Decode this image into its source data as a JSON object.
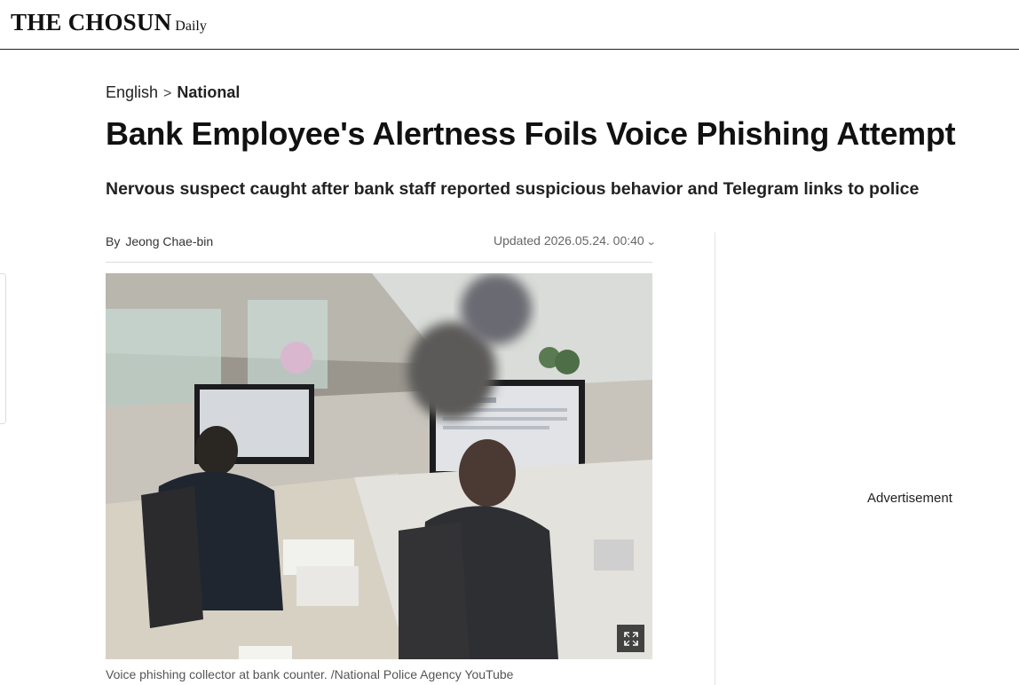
{
  "header": {
    "logo_main": "THE CHOSUN",
    "logo_sub": "Daily"
  },
  "breadcrumb": {
    "section": "English",
    "separator": ">",
    "current": "National"
  },
  "article": {
    "headline": "Bank Employee's Alertness Foils Voice Phishing Attempt",
    "subheadline": "Nervous suspect caught after bank staff reported suspicious behavior and Telegram links to police",
    "byline_prefix": "By",
    "author": "Jeong Chae-bin",
    "updated_label": "Updated 2026.05.24. 00:40",
    "image_caption": "Voice phishing collector at bank counter. /National Police Agency YouTube"
  },
  "icons": {
    "updated_toggle": "chevron-down-icon",
    "image_expand": "expand-icon"
  },
  "sidebar": {
    "ad_label": "Advertisement"
  }
}
